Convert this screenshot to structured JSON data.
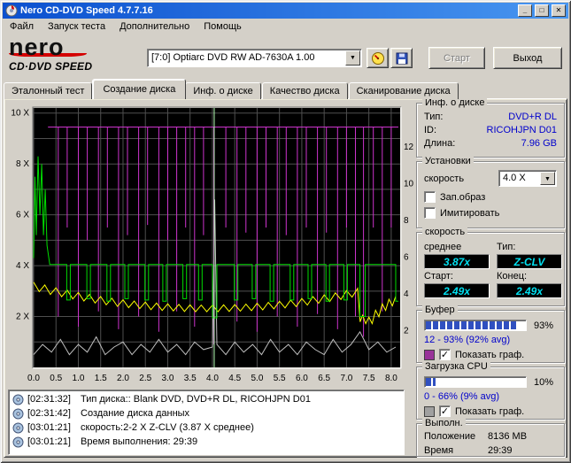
{
  "glyphs": {
    "check": "✓",
    "arrow_down": "▼",
    "min": "_",
    "max": "□",
    "close": "✕"
  },
  "window": {
    "title": "Nero CD-DVD Speed 4.7.7.16"
  },
  "menu": {
    "items": [
      "Файл",
      "Запуск теста",
      "Дополнительно",
      "Помощь"
    ]
  },
  "logo": {
    "line1": "nero",
    "line2": "CD·DVD SPEED"
  },
  "toolbar": {
    "drive": "[7:0]   Optiarc DVD RW AD-7630A 1.00",
    "start": "Старт",
    "exit": "Выход"
  },
  "tabs": [
    "Эталонный тест",
    "Создание диска",
    "Инф. о диске",
    "Качество диска",
    "Сканирование диска"
  ],
  "disc_info": {
    "title": "Инф. о диске",
    "type_label": "Тип:",
    "type": "DVD+R DL",
    "id_label": "ID:",
    "id": "RICOHJPN D01",
    "length_label": "Длина:",
    "length": "7.96 GB"
  },
  "settings": {
    "title": "Установки",
    "speed_label": "скорость",
    "speed_value": "4.0 X",
    "cb1": "Зап.образ",
    "cb1_checked": false,
    "cb2": "Имитировать",
    "cb2_checked": false
  },
  "speed": {
    "title": "скорость",
    "avg_label": "среднее",
    "avg": "3.87x",
    "type_label": "Тип:",
    "type": "Z-CLV",
    "start_label": "Старт:",
    "start": "2.49x",
    "end_label": "Конец:",
    "end": "2.49x"
  },
  "buffer": {
    "title": "Буфер",
    "percent": 93,
    "percent_label": "93%",
    "range": "12 - 93% (92% avg)",
    "swatch": "#993399",
    "checked": true,
    "show": "Показать граф."
  },
  "cpu": {
    "title": "Загрузка CPU",
    "percent": 10,
    "percent_label": "10%",
    "range": "0 - 66% (9% avg)",
    "swatch": "#a0a0a0",
    "checked": true,
    "show": "Показать граф."
  },
  "result": {
    "title": "Выполн.",
    "pos_label": "Положение",
    "pos": "8136 MB",
    "time_label": "Время",
    "time": "29:39"
  },
  "log": {
    "entries": [
      {
        "time": "[02:31:32]",
        "text": "Тип диска:: Blank DVD, DVD+R DL, RICOHJPN D01"
      },
      {
        "time": "[02:31:42]",
        "text": "Создание диска данных"
      },
      {
        "time": "[03:01:21]",
        "text": "скорость:2-2 X Z-CLV (3.87 X среднее)"
      },
      {
        "time": "[03:01:21]",
        "text": "Время выполнения: 29:39"
      }
    ]
  },
  "chart_data": {
    "type": "line",
    "bg": "#000000",
    "grid": "#4f4f4f",
    "x_axis": {
      "max": 8.2,
      "tick_step": 0.5,
      "ticks": [
        "0.0",
        "0.5",
        "1.0",
        "1.5",
        "2.0",
        "2.5",
        "3.0",
        "3.5",
        "4.0",
        "4.5",
        "5.0",
        "5.5",
        "6.0",
        "6.5",
        "7.0",
        "7.5",
        "8.0"
      ]
    },
    "y_left": {
      "max": 10.2,
      "ticks": [
        2,
        4,
        6,
        8,
        10
      ],
      "suffix": " X"
    },
    "y_right": {
      "ticks": [
        12,
        10,
        8,
        6,
        4,
        2
      ],
      "mbps_per_x": 1.385
    },
    "series": [
      {
        "name": "cpu-usage",
        "color": "#bfbfbf",
        "points": [
          [
            0,
            0.5
          ],
          [
            0.2,
            0.9
          ],
          [
            0.4,
            0.6
          ],
          [
            0.6,
            1.1
          ],
          [
            0.8,
            0.5
          ],
          [
            1,
            0.9
          ],
          [
            1.2,
            0.6
          ],
          [
            1.4,
            1.2
          ],
          [
            1.6,
            0.5
          ],
          [
            1.8,
            0.8
          ],
          [
            2,
            1.0
          ],
          [
            2.2,
            0.5
          ],
          [
            2.4,
            0.9
          ],
          [
            2.6,
            0.6
          ],
          [
            2.8,
            1.1
          ],
          [
            3,
            0.6
          ],
          [
            3.2,
            0.9
          ],
          [
            3.4,
            0.5
          ],
          [
            3.6,
            1.0
          ],
          [
            3.8,
            0.7
          ],
          [
            4,
            0.8
          ],
          [
            4.05,
            6.6
          ],
          [
            4.1,
            0.9
          ],
          [
            4.3,
            0.5
          ],
          [
            4.5,
            1.0
          ],
          [
            4.7,
            0.6
          ],
          [
            4.9,
            0.9
          ],
          [
            5.1,
            0.5
          ],
          [
            5.3,
            1.1
          ],
          [
            5.5,
            0.6
          ],
          [
            5.7,
            0.9
          ],
          [
            5.9,
            0.5
          ],
          [
            6.1,
            1.0
          ],
          [
            6.3,
            0.7
          ],
          [
            6.5,
            0.5
          ],
          [
            6.7,
            1.1
          ],
          [
            6.9,
            0.6
          ],
          [
            7.1,
            0.9
          ],
          [
            7.3,
            1.4
          ],
          [
            7.5,
            0.7
          ],
          [
            7.7,
            1.0
          ],
          [
            7.9,
            0.6
          ],
          [
            8.1,
            0.8
          ]
        ]
      },
      {
        "name": "buffer-level",
        "color": "#cc33cc",
        "baseline": 9.45,
        "span": [
          0.32,
          8.16
        ],
        "dips": [
          [
            0.55,
            2.0
          ],
          [
            0.75,
            5.5
          ],
          [
            1.0,
            1.6
          ],
          [
            1.2,
            5.0
          ],
          [
            1.45,
            2.2
          ],
          [
            1.65,
            5.5
          ],
          [
            1.9,
            1.5
          ],
          [
            2.1,
            5.2
          ],
          [
            2.35,
            2.0
          ],
          [
            2.55,
            5.6
          ],
          [
            2.8,
            1.4
          ],
          [
            3.0,
            5.0
          ],
          [
            3.2,
            2.2
          ],
          [
            3.4,
            5.5
          ],
          [
            3.6,
            1.6
          ],
          [
            3.8,
            5.2
          ],
          [
            4.03,
            0.9
          ],
          [
            4.3,
            5.5
          ],
          [
            4.55,
            1.8
          ],
          [
            4.75,
            5.3
          ],
          [
            5.0,
            1.4
          ],
          [
            5.2,
            5.5
          ],
          [
            5.45,
            2.0
          ],
          [
            5.65,
            5.2
          ],
          [
            5.9,
            1.6
          ],
          [
            6.1,
            5.5
          ],
          [
            6.35,
            2.1
          ],
          [
            6.55,
            5.3
          ],
          [
            6.8,
            1.5
          ],
          [
            7.0,
            5.5
          ],
          [
            7.2,
            2.0
          ],
          [
            7.38,
            1.2
          ],
          [
            7.6,
            5.5
          ],
          [
            7.8,
            2.2
          ],
          [
            8.0,
            5.5
          ]
        ]
      },
      {
        "name": "transfer-rate",
        "color": "#ffff00",
        "teeth_depth": 0.26,
        "points": [
          [
            0,
            3.35
          ],
          [
            0.25,
            3.24
          ],
          [
            0.5,
            3.13
          ],
          [
            0.75,
            3.04
          ],
          [
            1,
            2.95
          ],
          [
            1.25,
            2.87
          ],
          [
            1.5,
            2.79
          ],
          [
            1.75,
            2.72
          ],
          [
            2,
            2.66
          ],
          [
            2.25,
            2.61
          ],
          [
            2.5,
            2.57
          ],
          [
            2.75,
            2.53
          ],
          [
            3,
            2.5
          ],
          [
            3.25,
            2.48
          ],
          [
            3.5,
            2.46
          ],
          [
            3.75,
            2.45
          ],
          [
            4,
            2.45
          ],
          [
            4.25,
            2.46
          ],
          [
            4.5,
            2.47
          ],
          [
            4.75,
            2.49
          ],
          [
            5,
            2.52
          ],
          [
            5.25,
            2.56
          ],
          [
            5.5,
            2.6
          ],
          [
            5.75,
            2.65
          ],
          [
            6,
            2.71
          ],
          [
            6.25,
            2.78
          ],
          [
            6.5,
            2.85
          ],
          [
            6.75,
            2.93
          ],
          [
            7,
            3.02
          ],
          [
            7.25,
            3.11
          ],
          [
            7.36,
            2.05
          ],
          [
            7.5,
            1.98
          ],
          [
            7.65,
            2.25
          ],
          [
            7.8,
            2.5
          ],
          [
            7.95,
            2.68
          ],
          [
            8.1,
            2.8
          ]
        ]
      },
      {
        "name": "write-speed",
        "color": "#00dd00",
        "points": [
          [
            0,
            4.3
          ],
          [
            0.03,
            7.5
          ],
          [
            0.06,
            5.2
          ],
          [
            0.1,
            8.3
          ],
          [
            0.14,
            6.0
          ],
          [
            0.18,
            8.0
          ],
          [
            0.22,
            5.2
          ],
          [
            0.26,
            7.0
          ],
          [
            0.3,
            4.8
          ],
          [
            0.36,
            4.05
          ],
          [
            0.74,
            4.05
          ],
          [
            0.74,
            2.65
          ],
          [
            0.82,
            2.65
          ],
          [
            0.82,
            4.05
          ],
          [
            1.19,
            4.05
          ],
          [
            1.19,
            2.7
          ],
          [
            1.27,
            2.7
          ],
          [
            1.27,
            4.05
          ],
          [
            1.64,
            4.05
          ],
          [
            1.64,
            2.6
          ],
          [
            1.72,
            2.6
          ],
          [
            1.72,
            4.05
          ],
          [
            2.04,
            4.05
          ],
          [
            2.04,
            2.7
          ],
          [
            2.12,
            2.7
          ],
          [
            2.12,
            4.05
          ],
          [
            2.49,
            4.05
          ],
          [
            2.49,
            2.65
          ],
          [
            2.57,
            2.65
          ],
          [
            2.57,
            4.05
          ],
          [
            2.89,
            4.05
          ],
          [
            2.89,
            2.6
          ],
          [
            2.97,
            2.6
          ],
          [
            2.97,
            4.05
          ],
          [
            3.34,
            4.05
          ],
          [
            3.34,
            2.7
          ],
          [
            3.42,
            2.7
          ],
          [
            3.42,
            4.05
          ],
          [
            3.69,
            4.05
          ],
          [
            3.69,
            2.65
          ],
          [
            3.77,
            2.65
          ],
          [
            3.77,
            4.05
          ],
          [
            4.0,
            4.05
          ],
          [
            4.0,
            1.95
          ],
          [
            4.1,
            1.95
          ],
          [
            4.1,
            4.05
          ],
          [
            4.49,
            4.05
          ],
          [
            4.49,
            2.65
          ],
          [
            4.57,
            2.65
          ],
          [
            4.57,
            4.05
          ],
          [
            4.89,
            4.05
          ],
          [
            4.89,
            2.7
          ],
          [
            4.97,
            2.7
          ],
          [
            4.97,
            4.05
          ],
          [
            5.29,
            4.05
          ],
          [
            5.29,
            2.6
          ],
          [
            5.37,
            2.6
          ],
          [
            5.37,
            4.05
          ],
          [
            5.74,
            4.05
          ],
          [
            5.74,
            2.65
          ],
          [
            5.82,
            2.65
          ],
          [
            5.82,
            4.05
          ],
          [
            6.14,
            4.05
          ],
          [
            6.14,
            2.7
          ],
          [
            6.22,
            2.7
          ],
          [
            6.22,
            4.05
          ],
          [
            6.54,
            4.05
          ],
          [
            6.54,
            2.6
          ],
          [
            6.62,
            2.6
          ],
          [
            6.62,
            4.05
          ],
          [
            6.94,
            4.05
          ],
          [
            6.94,
            2.65
          ],
          [
            7.02,
            2.65
          ],
          [
            7.02,
            4.05
          ],
          [
            7.3,
            4.05
          ],
          [
            7.3,
            2.0
          ],
          [
            7.42,
            2.0
          ],
          [
            7.42,
            4.05
          ],
          [
            8.1,
            4.05
          ],
          [
            8.1,
            2.6
          ],
          [
            8.16,
            2.6
          ]
        ]
      },
      {
        "name": "layer-break-marker",
        "color": "#b3ffb3",
        "vline": 4.04
      }
    ]
  }
}
